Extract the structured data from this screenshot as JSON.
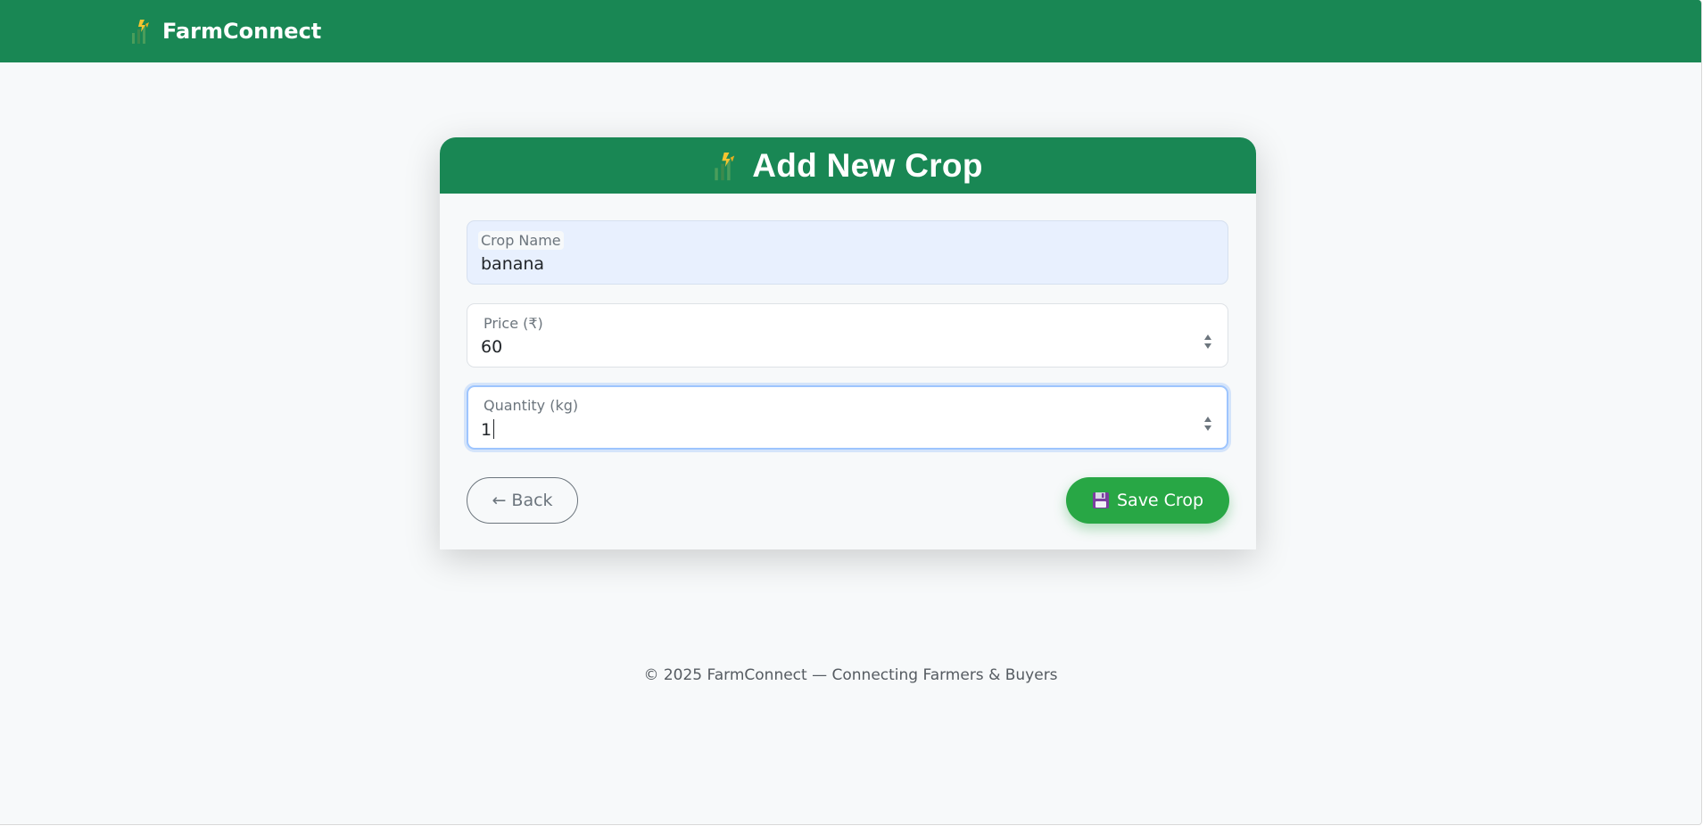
{
  "navbar": {
    "brand": "FarmConnect",
    "brand_icon": "crop-icon"
  },
  "form": {
    "title": "Add New Crop",
    "title_icon": "crop-icon",
    "fields": [
      {
        "label": "Crop Name",
        "value": "banana",
        "state": "autofilled"
      },
      {
        "label": "Price (₹)",
        "value": "60",
        "state": "default"
      },
      {
        "label": "Quantity (kg)",
        "value": "1",
        "state": "focused"
      }
    ],
    "back_label": "← Back",
    "save_label": "Save Crop",
    "save_icon": "floppy-disk-icon"
  },
  "footer": {
    "text": "© 2025 FarmConnect — Connecting Farmers & Buyers"
  },
  "colors": {
    "brand_green": "#198754",
    "save_green": "#28a745",
    "background": "#f7f9fa",
    "focus_ring": "#9ec5fe",
    "autofill": "#e8f0fe"
  }
}
